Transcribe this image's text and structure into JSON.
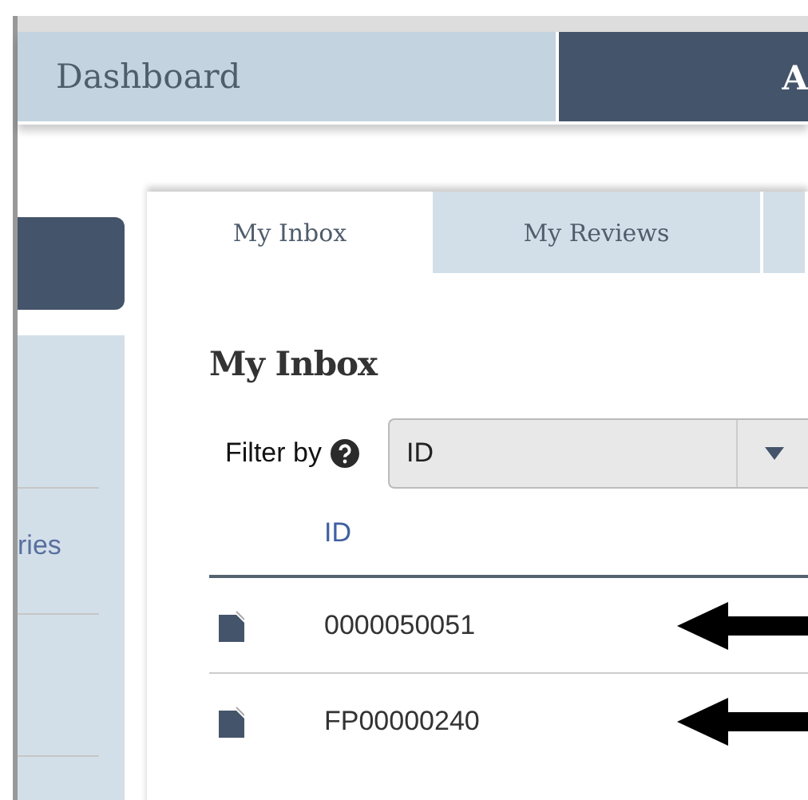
{
  "nav": [
    {
      "label": "Dashboard",
      "selected": false
    },
    {
      "label": "A",
      "selected": true
    }
  ],
  "sidebar": {
    "link": "ries"
  },
  "tabs": [
    {
      "label": "My Inbox",
      "selected": true
    },
    {
      "label": "My Reviews",
      "selected": false
    },
    {
      "selected": false
    }
  ],
  "heading": "My Inbox",
  "filter": {
    "label": "Filter by",
    "value": "ID"
  },
  "table": {
    "columns": [
      "ID"
    ],
    "rows": [
      {
        "id": "0000050051",
        "marked": true
      },
      {
        "id": "FP00000240",
        "marked": true
      }
    ]
  }
}
